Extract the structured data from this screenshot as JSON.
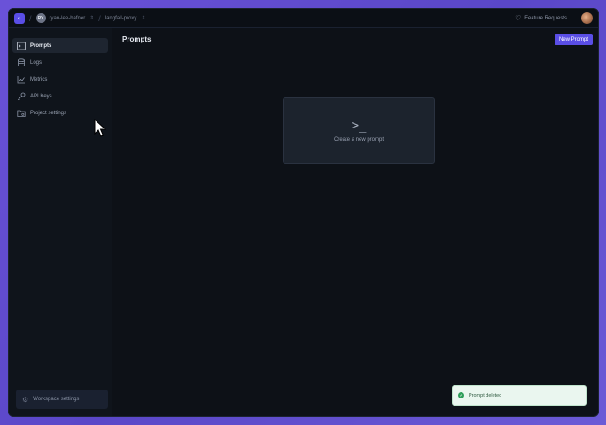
{
  "topbar": {
    "workspace_initials": "RY",
    "workspace_name": "ryan-lee-hafner",
    "project_name": "langfall-proxy",
    "feature_requests_label": "Feature Requests"
  },
  "sidebar": {
    "items": [
      {
        "label": "Prompts",
        "icon": "terminal-icon",
        "active": true
      },
      {
        "label": "Logs",
        "icon": "database-icon",
        "active": false
      },
      {
        "label": "Metrics",
        "icon": "chart-icon",
        "active": false
      },
      {
        "label": "API Keys",
        "icon": "key-icon",
        "active": false
      },
      {
        "label": "Project settings",
        "icon": "folder-gear-icon",
        "active": false
      }
    ],
    "workspace_settings_label": "Workspace settings"
  },
  "main": {
    "title": "Prompts",
    "new_button_label": "New Prompt",
    "create_card_label": "Create a new prompt",
    "create_card_icon": ">_"
  },
  "toast": {
    "message": "Prompt deleted",
    "status": "success"
  },
  "colors": {
    "accent": "#5a4ee6",
    "background": "#0d1117",
    "sidebar": "#0f141b",
    "toast_bg": "#eaf6ef"
  }
}
